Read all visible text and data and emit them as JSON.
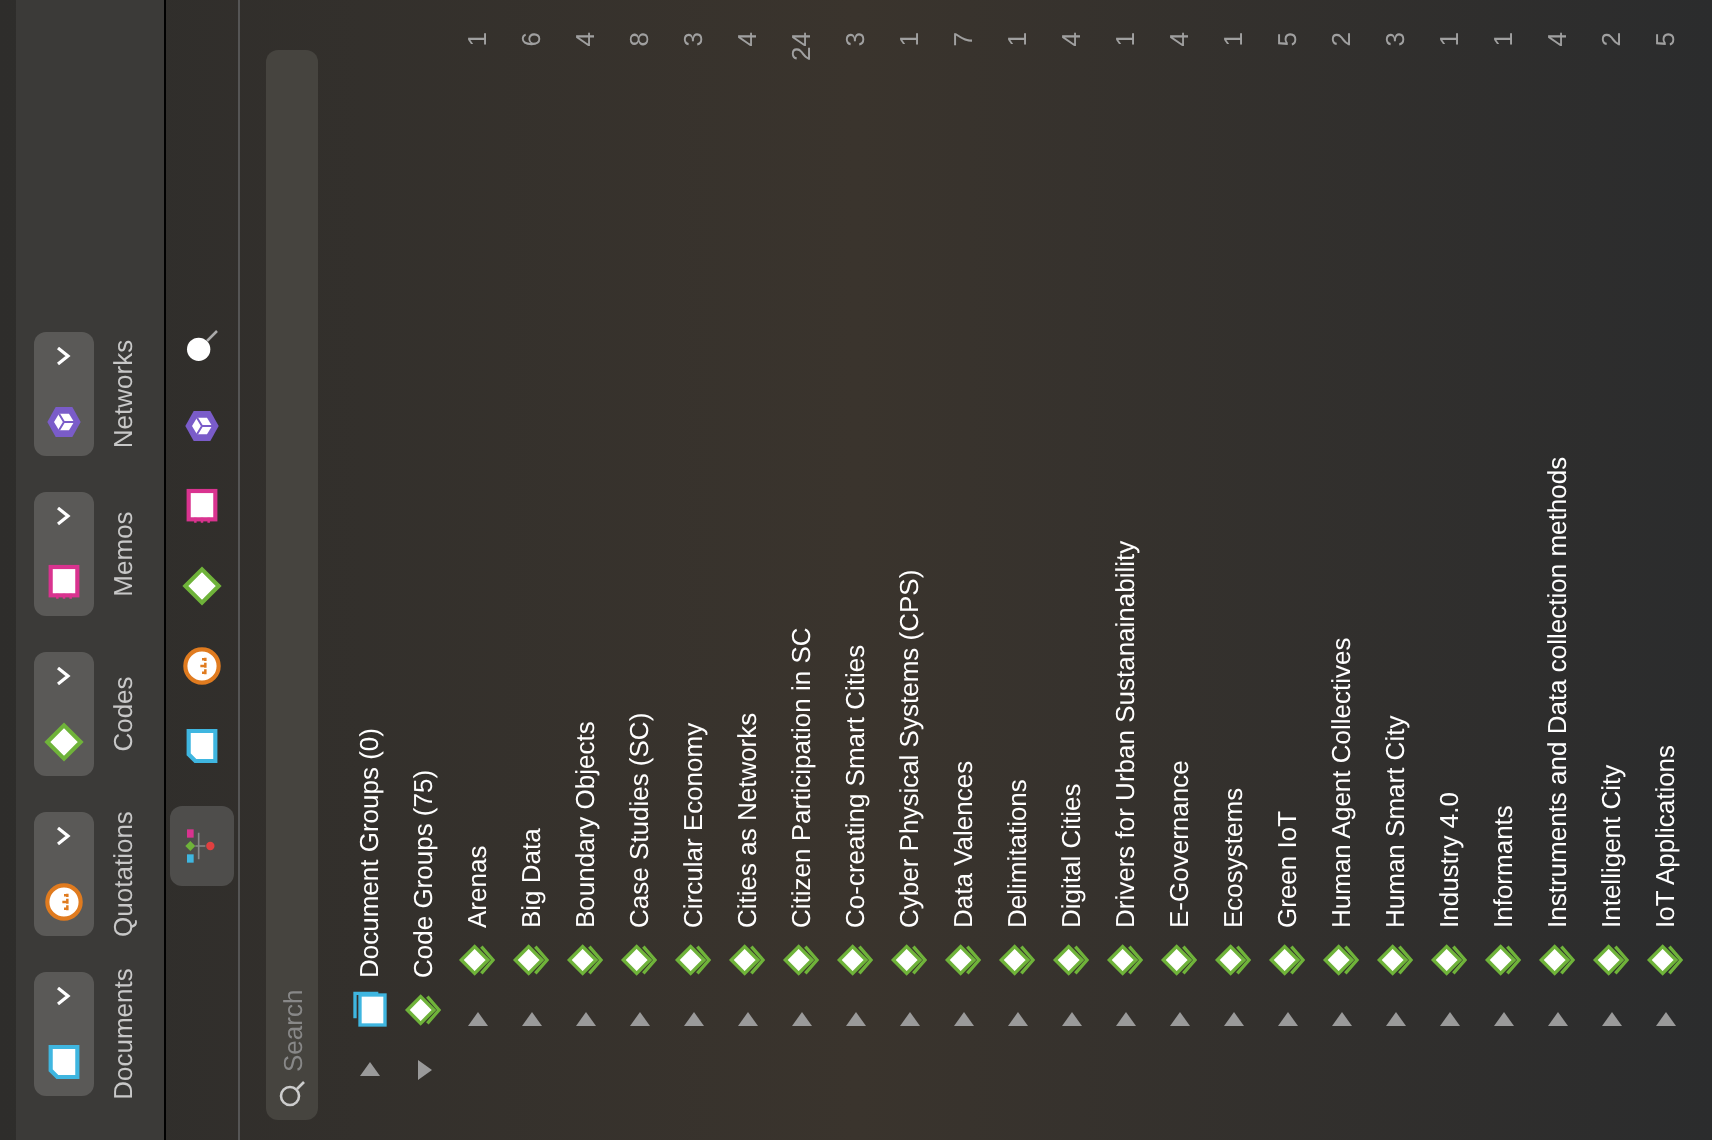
{
  "tabs": [
    {
      "label": "Documents",
      "kind": "document"
    },
    {
      "label": "Quotations",
      "kind": "quotation"
    },
    {
      "label": "Codes",
      "kind": "code"
    },
    {
      "label": "Memos",
      "kind": "memo"
    },
    {
      "label": "Networks",
      "kind": "network"
    }
  ],
  "toolbar": [
    {
      "kind": "tree",
      "selected": true
    },
    {
      "kind": "document",
      "selected": false
    },
    {
      "kind": "quotation",
      "selected": false
    },
    {
      "kind": "code",
      "selected": false
    },
    {
      "kind": "memo",
      "selected": false
    },
    {
      "kind": "network",
      "selected": false
    },
    {
      "kind": "search",
      "selected": false
    }
  ],
  "search": {
    "placeholder": "Search"
  },
  "tree": [
    {
      "label": "Document Groups (0)",
      "kind": "document-group",
      "expanded": false
    },
    {
      "label": "Code Groups (75)",
      "kind": "code-group",
      "expanded": true,
      "children": [
        {
          "label": "Arenas",
          "count": "1",
          "expanded": false
        },
        {
          "label": "Big Data",
          "count": "6",
          "expanded": false
        },
        {
          "label": "Boundary Objects",
          "count": "4",
          "expanded": false
        },
        {
          "label": "Case Studies (SC)",
          "count": "8",
          "expanded": false
        },
        {
          "label": "Circular Economy",
          "count": "3",
          "expanded": false
        },
        {
          "label": "Cities as Networks",
          "count": "4",
          "expanded": false
        },
        {
          "label": "Citizen Participation in SC",
          "count": "24",
          "expanded": false
        },
        {
          "label": "Co-creating Smart Cities",
          "count": "3",
          "expanded": false
        },
        {
          "label": "Cyber Physical Systems (CPS)",
          "count": "1",
          "expanded": false
        },
        {
          "label": "Data Valences",
          "count": "7",
          "expanded": false
        },
        {
          "label": "Delimitations",
          "count": "1",
          "expanded": false
        },
        {
          "label": "Digital Cities",
          "count": "4",
          "expanded": false
        },
        {
          "label": "Drivers for Urban Sustanainability",
          "count": "1",
          "expanded": false
        },
        {
          "label": "E-Governance",
          "count": "4",
          "expanded": false
        },
        {
          "label": "Ecosystems",
          "count": "1",
          "expanded": false
        },
        {
          "label": "Green IoT",
          "count": "5",
          "expanded": false
        },
        {
          "label": "Human Agent Collectives",
          "count": "2",
          "expanded": false
        },
        {
          "label": "Human Smart City",
          "count": "3",
          "expanded": false
        },
        {
          "label": "Industry 4.0",
          "count": "1",
          "expanded": false
        },
        {
          "label": "Informants",
          "count": "1",
          "expanded": false
        },
        {
          "label": "Instruments and Data collection methods",
          "count": "4",
          "expanded": false
        },
        {
          "label": "Intelligent City",
          "count": "2",
          "expanded": false
        },
        {
          "label": "IoT Applications",
          "count": "5",
          "expanded": false
        }
      ]
    }
  ]
}
